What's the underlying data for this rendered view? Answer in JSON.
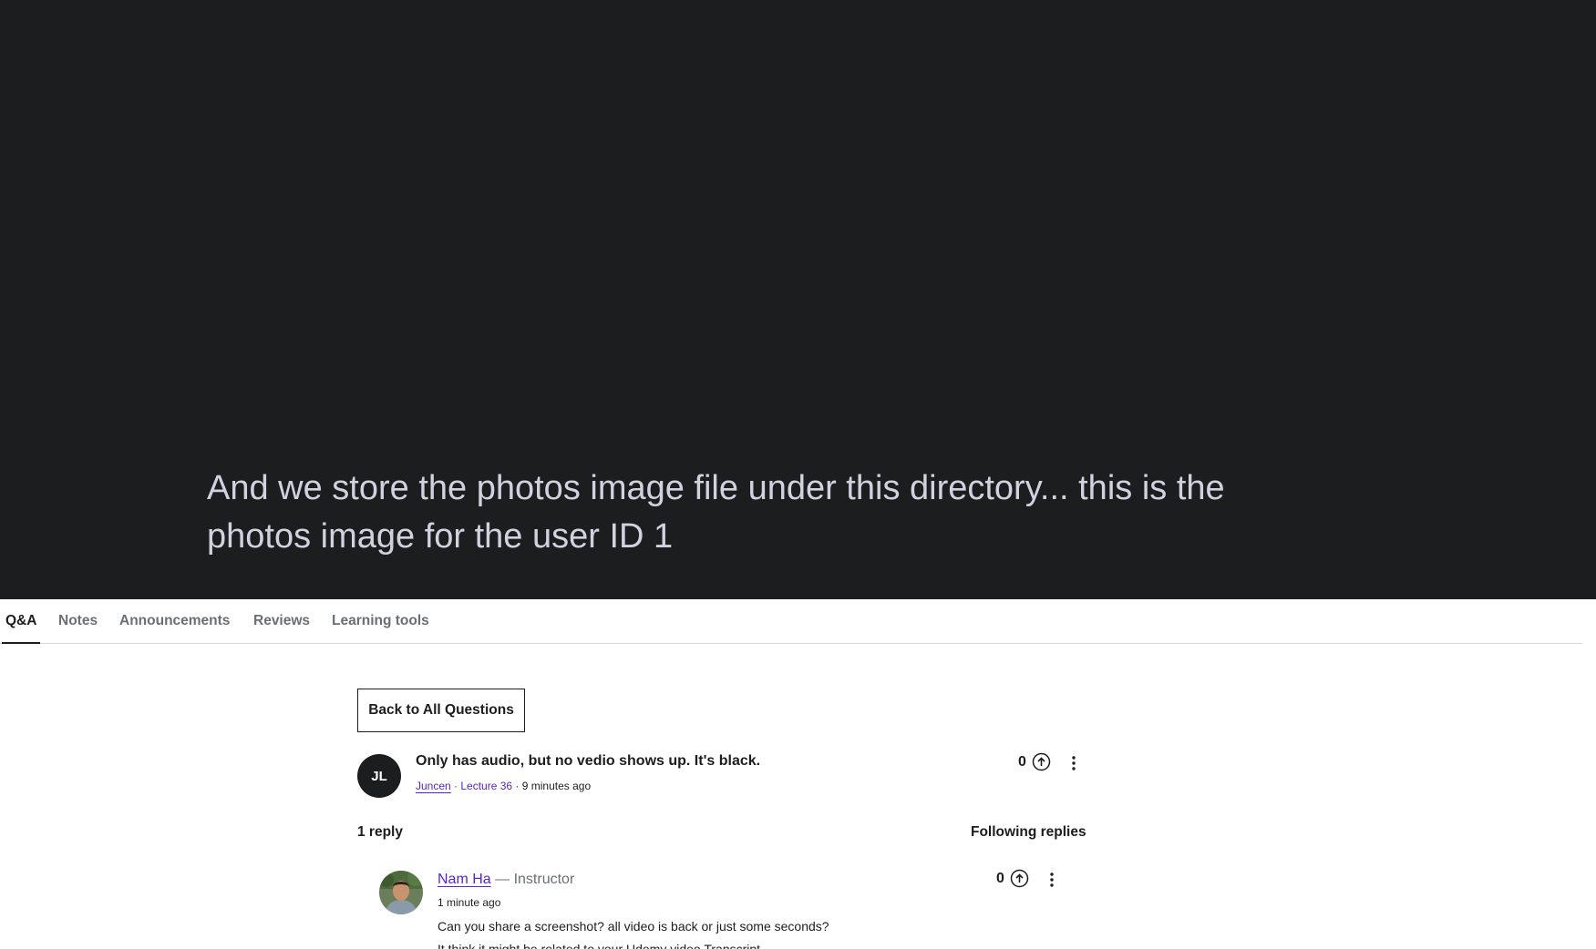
{
  "video": {
    "caption": "And we store the photos image file under this directory... this is the photos image for the user ID 1"
  },
  "tabs": [
    {
      "label": "Q&A",
      "active": true
    },
    {
      "label": "Notes",
      "active": false
    },
    {
      "label": "Announcements",
      "active": false
    },
    {
      "label": "Reviews",
      "active": false
    },
    {
      "label": "Learning tools",
      "active": false
    }
  ],
  "back_button": "Back to All Questions",
  "question": {
    "avatar_initials": "JL",
    "title": "Only has audio, but no vedio shows up. It's black.",
    "author": "Juncen",
    "separator1": " · ",
    "lecture": "Lecture 36",
    "separator2": " · ",
    "time": "9 minutes ago",
    "votes": "0"
  },
  "replies_header": {
    "count_label": "1 reply",
    "following_label": "Following replies"
  },
  "reply": {
    "author": "Nam Ha",
    "role": " — Instructor",
    "time": "1 minute ago",
    "body_line1": "Can you share a screenshot? all video is back or just some seconds?",
    "body_line2": "It think it might be related to your Udemy video Transcript.",
    "votes": "0"
  },
  "colors": {
    "video_bg": "#1c1d1f",
    "link_purple": "#5624d0",
    "caption_text": "#d1d2e0"
  },
  "icons": [
    "upvote-icon",
    "more-options-icon"
  ]
}
